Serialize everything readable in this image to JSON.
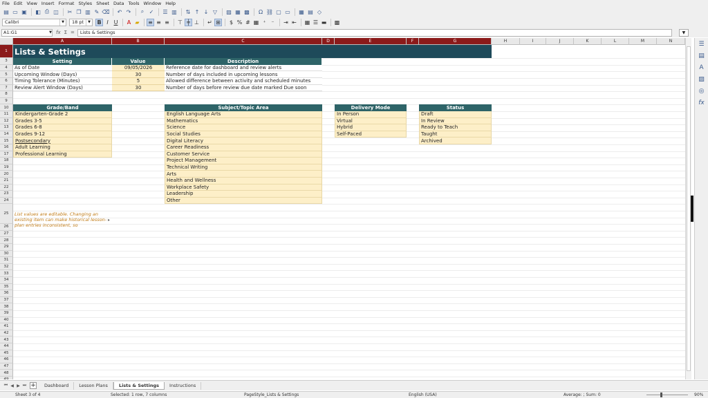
{
  "menu": [
    "File",
    "Edit",
    "View",
    "Insert",
    "Format",
    "Styles",
    "Sheet",
    "Data",
    "Tools",
    "Window",
    "Help"
  ],
  "format_toolbar": {
    "font_name": "Calibri",
    "font_size": "18 pt"
  },
  "formula_bar": {
    "name_box": "A1:G1",
    "content": "Lists & Settings"
  },
  "columns": [
    "A",
    "B",
    "C",
    "D",
    "E",
    "F",
    "G",
    "H",
    "I",
    "J",
    "K",
    "L",
    "M",
    "N"
  ],
  "title": "Lists & Settings",
  "settings_table": {
    "headers": [
      "Setting",
      "Value",
      "Description"
    ],
    "rows": [
      {
        "setting": "As of Date",
        "value": "09/05/2026",
        "description": "Reference date for dashboard and review alerts"
      },
      {
        "setting": "Upcoming Window (Days)",
        "value": "30",
        "description": "Number of days included in upcoming lessons"
      },
      {
        "setting": "Timing Tolerance (Minutes)",
        "value": "5",
        "description": "Allowed difference between activity and scheduled minutes"
      },
      {
        "setting": "Review Alert Window (Days)",
        "value": "30",
        "description": "Number of days before review due date marked Due soon"
      }
    ]
  },
  "lists": {
    "grade_band": {
      "header": "Grade/Band",
      "items": [
        "Kindergarten-Grade 2",
        "Grades 3-5",
        "Grades 6-8",
        "Grades 9-12",
        "Postsecondary",
        "Adult Learning",
        "Professional Learning"
      ]
    },
    "subject": {
      "header": "Subject/Topic Area",
      "items": [
        "English Language Arts",
        "Mathematics",
        "Science",
        "Social Studies",
        "Digital Literacy",
        "Career Readiness",
        "Customer Service",
        "Project Management",
        "Technical Writing",
        "Arts",
        "Health and Wellness",
        "Workplace Safety",
        "Leadership",
        "Other"
      ]
    },
    "delivery_mode": {
      "header": "Delivery Mode",
      "items": [
        "In Person",
        "Virtual",
        "Hybrid",
        "Self-Paced"
      ]
    },
    "status": {
      "header": "Status",
      "items": [
        "Draft",
        "In Review",
        "Ready to Teach",
        "Taught",
        "Archived"
      ]
    }
  },
  "note": "List values are editable. Changing an existing item can make historical lesson-plan entries inconsistent, so",
  "sheet_tabs": [
    "Dashboard",
    "Lesson Plans",
    "Lists & Settings",
    "Instructions"
  ],
  "active_tab": "Lists & Settings",
  "status_bar": {
    "sheet": "Sheet 3 of 4",
    "selection": "Selected: 1 row, 7 columns",
    "page_style": "PageStyle_Lists & Settings",
    "language": "English (USA)",
    "summary": "Average: ; Sum: 0",
    "zoom": "90%"
  },
  "colors": {
    "title_bg": "#1e4a5a",
    "header_bg": "#2e6468",
    "list_fill": "#fdefc8",
    "note_text": "#c07a14",
    "selected_header": "#8b1a1a"
  }
}
